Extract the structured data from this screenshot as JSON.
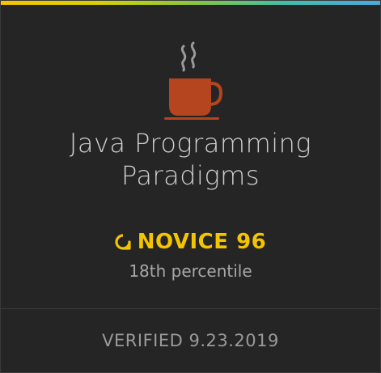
{
  "badge": {
    "icon": "coffee-cup-icon",
    "icon_color": "#b5451f",
    "steam_color": "#9a9a9a",
    "title_lines": [
      "Java Programming",
      "Paradigms"
    ],
    "level_icon": "skill-level-icon",
    "level_label": "NOVICE 96",
    "level_color": "#f5c400",
    "percentile": "18th percentile",
    "verified": "VERIFIED 9.23.2019",
    "stripe_colors": [
      "#f5c400",
      "#d8d200",
      "#8cc63f",
      "#3fc0a8",
      "#4aa9e0"
    ]
  }
}
